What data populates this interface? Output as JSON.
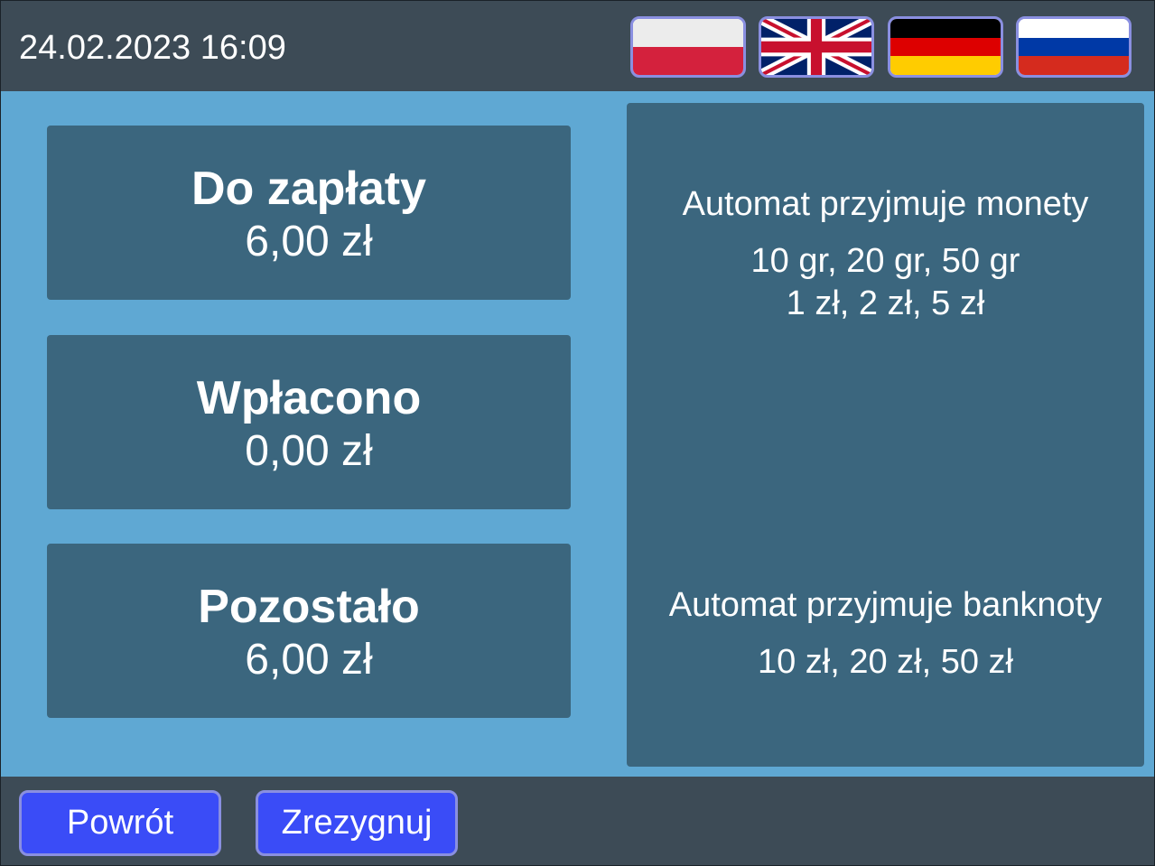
{
  "header": {
    "datetime": "24.02.2023 16:09",
    "languages": [
      {
        "code": "pl",
        "icon": "flag-pl-icon"
      },
      {
        "code": "en",
        "icon": "flag-gb-icon"
      },
      {
        "code": "de",
        "icon": "flag-de-icon"
      },
      {
        "code": "ru",
        "icon": "flag-ru-icon"
      }
    ]
  },
  "payment": {
    "due_label": "Do zapłaty",
    "due_value": "6,00 zł",
    "paid_label": "Wpłacono",
    "paid_value": "0,00 zł",
    "remaining_label": "Pozostało",
    "remaining_value": "6,00 zł"
  },
  "info": {
    "coins_title": "Automat przyjmuje monety",
    "coins_line1": "10 gr, 20 gr, 50 gr",
    "coins_line2": "1 zł, 2 zł, 5 zł",
    "notes_title": "Automat przyjmuje banknoty",
    "notes_line1": "10 zł, 20 zł, 50 zł"
  },
  "footer": {
    "back_label": "Powrót",
    "cancel_label": "Zrezygnuj"
  },
  "colors": {
    "header_bg": "#3d4b56",
    "main_bg": "#5fa8d3",
    "card_bg": "#3b667e",
    "button_bg": "#3a4cf7",
    "button_border": "#8a8fe0"
  }
}
